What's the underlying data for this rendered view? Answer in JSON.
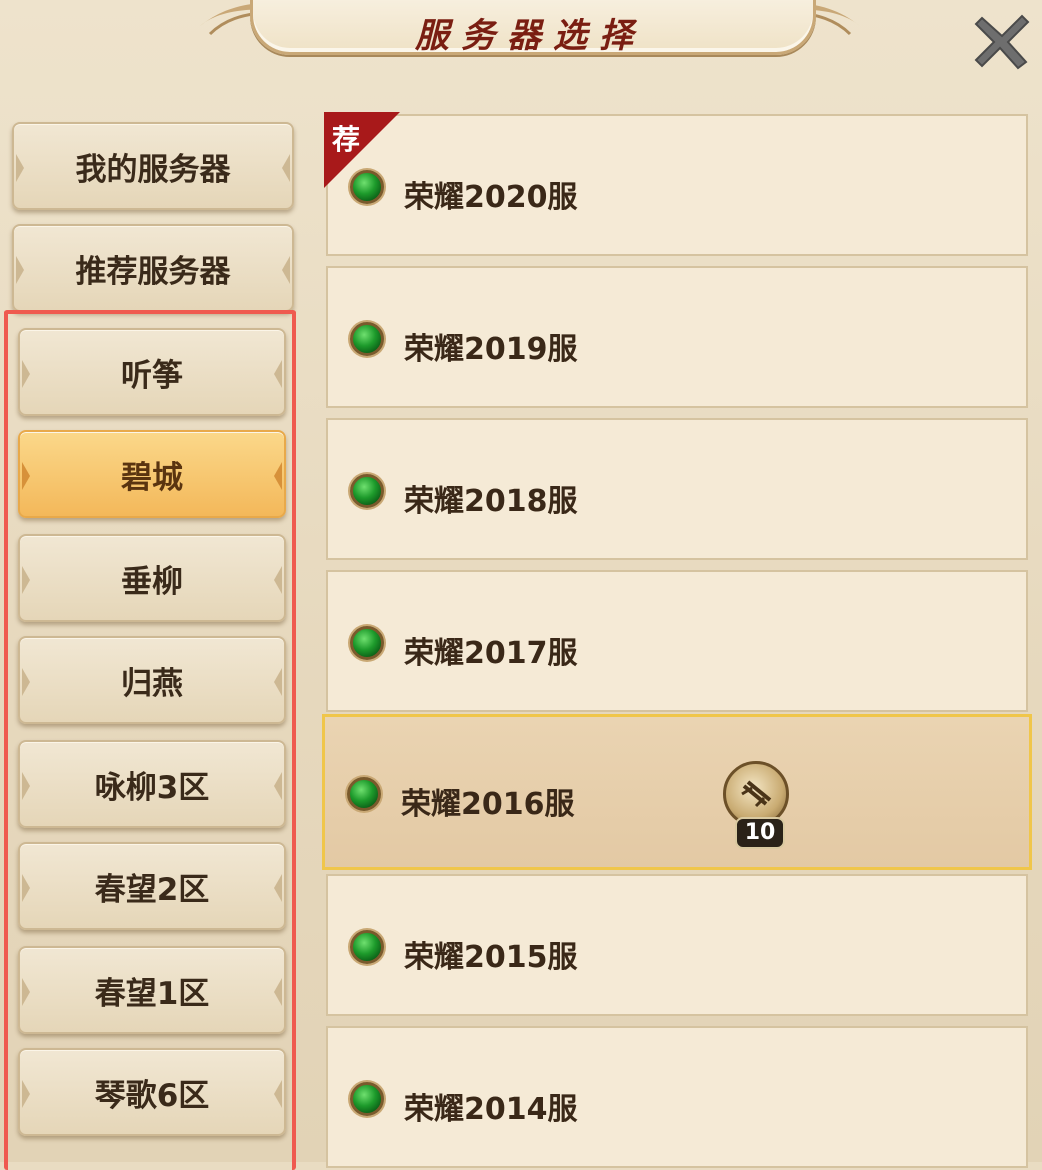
{
  "header": {
    "title": "服务器选择",
    "close_icon": "close-icon"
  },
  "nav": {
    "my_servers": "我的服务器",
    "recommended": "推荐服务器",
    "zones": [
      {
        "label": "听筝",
        "active": false
      },
      {
        "label": "碧城",
        "active": true
      },
      {
        "label": "垂柳",
        "active": false
      },
      {
        "label": "归燕",
        "active": false
      },
      {
        "label": "咏柳3区",
        "active": false
      },
      {
        "label": "春望2区",
        "active": false
      },
      {
        "label": "春望1区",
        "active": false
      },
      {
        "label": "琴歌6区",
        "active": false
      }
    ]
  },
  "servers": [
    {
      "name": "荣耀2020服",
      "status": "green",
      "recommended_tag": "荐"
    },
    {
      "name": "荣耀2019服",
      "status": "green"
    },
    {
      "name": "荣耀2018服",
      "status": "green"
    },
    {
      "name": "荣耀2017服",
      "status": "green"
    },
    {
      "name": "荣耀2016服",
      "status": "green",
      "selected": true,
      "badge_count": "10",
      "badge_icon": "scroll-icon"
    },
    {
      "name": "荣耀2015服",
      "status": "green"
    },
    {
      "name": "荣耀2014服",
      "status": "green"
    }
  ],
  "colors": {
    "status_green": "#1d9a2b",
    "active_tab": "#f3b85a",
    "selected_border": "#f0c64a",
    "highlight_box": "#ef5a4f",
    "recommend_tag": "#a8191a"
  }
}
